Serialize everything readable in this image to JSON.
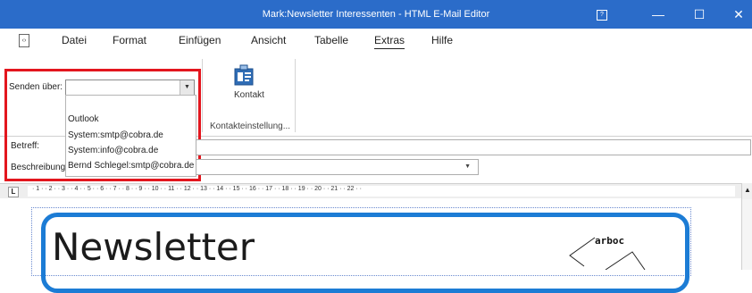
{
  "window": {
    "title": "Mark:Newsletter Interessenten - HTML E-Mail Editor",
    "controls": {
      "help": "?",
      "minimize": "—",
      "maximize": "☐",
      "close": "✕"
    }
  },
  "menu": {
    "items": [
      "Datei",
      "Format",
      "Einfügen",
      "Ansicht",
      "Tabelle",
      "Extras",
      "Hilfe"
    ],
    "active": "Extras"
  },
  "ribbon": {
    "senden_label": "Senden über:",
    "senden_value": "",
    "senden_options": [
      "Outlook",
      "System:smtp@cobra.de",
      "System:info@cobra.de",
      "Bernd Schlegel:smtp@cobra.de"
    ],
    "kontakt_label": "Kontakt",
    "group_label": "Kontakteinstellung..."
  },
  "fields": {
    "betreff_label": "Betreff:",
    "betreff_value": "",
    "beschreibung_label": "Beschreibung",
    "beschreibung_value": ""
  },
  "ruler": {
    "ticks": "· 1 · · 2 · · 3 · · 4 · · 5 · · 6 · · 7 · · 8 · · 9 · · 10 · · 11 · · 12 · · 13 · · 14 · · 15 · · 16 · · 17 · · 18 · · 19 · · 20 · · 21 · · 22 · ·",
    "tab_stop": "L"
  },
  "editor": {
    "heading": "Newsletter",
    "logo_text": "arboc"
  },
  "colors": {
    "titlebar": "#2b6cc9",
    "highlight": "#e3161e",
    "frame": "#1c7cd5"
  }
}
